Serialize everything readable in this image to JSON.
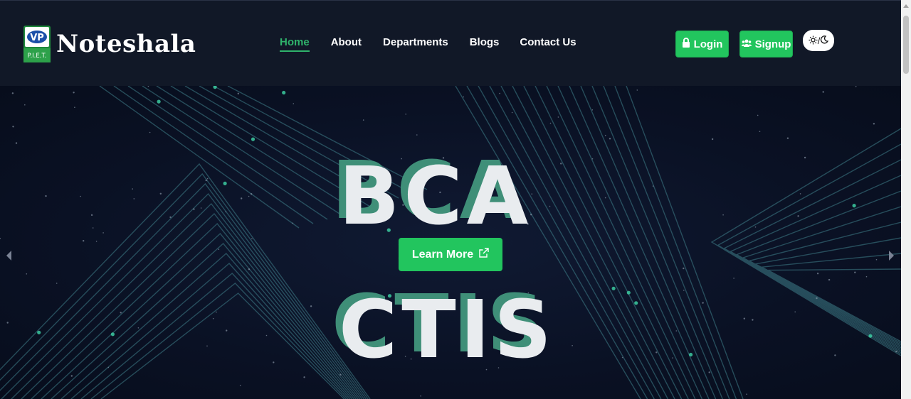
{
  "brand": {
    "name": "Noteshala",
    "logo_text": "P.I.E.T.",
    "logo_mark": "VP"
  },
  "nav": {
    "items": [
      {
        "label": "Home",
        "active": true
      },
      {
        "label": "About",
        "active": false
      },
      {
        "label": "Departments",
        "active": false
      },
      {
        "label": "Blogs",
        "active": false
      },
      {
        "label": "Contact Us",
        "active": false
      }
    ]
  },
  "actions": {
    "login_label": "Login",
    "signup_label": "Signup",
    "login_icon": "lock-icon",
    "signup_icon": "users-icon",
    "theme_toggle": {
      "light_icon": "sun-icon",
      "separator": "/",
      "dark_icon": "moon-icon"
    }
  },
  "hero": {
    "word_top": "BCA",
    "word_bottom": "CTIS",
    "cta_label": "Learn More",
    "cta_icon": "external-link-icon",
    "prev_icon": "chevron-left-icon",
    "next_icon": "chevron-right-icon"
  },
  "colors": {
    "accent": "#22c55e",
    "nav_bg": "#111827",
    "hero_bg": "#0a1124",
    "word_shadow": "#3f8f78"
  }
}
